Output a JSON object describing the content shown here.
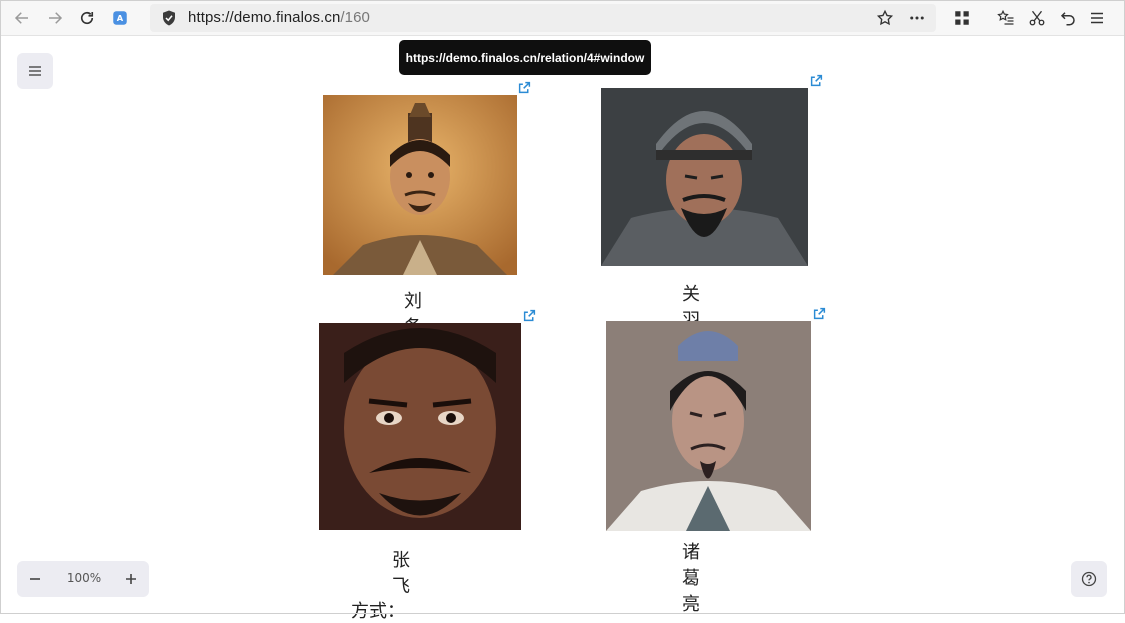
{
  "browser": {
    "url_host": "https://demo.finalos.cn",
    "url_path": "/160",
    "tooltip": "https://demo.finalos.cn/relation/4#window"
  },
  "characters": [
    {
      "name": "刘备"
    },
    {
      "name": "关羽"
    },
    {
      "name": "张飞"
    },
    {
      "name": "诸葛亮"
    }
  ],
  "zoom": {
    "value": "100%"
  },
  "page": {
    "method_label": "方式："
  },
  "colors": {
    "accent_link": "#2b8bd4",
    "panel_bg": "#ececf2",
    "tooltip_bg": "#0f0f0f"
  }
}
